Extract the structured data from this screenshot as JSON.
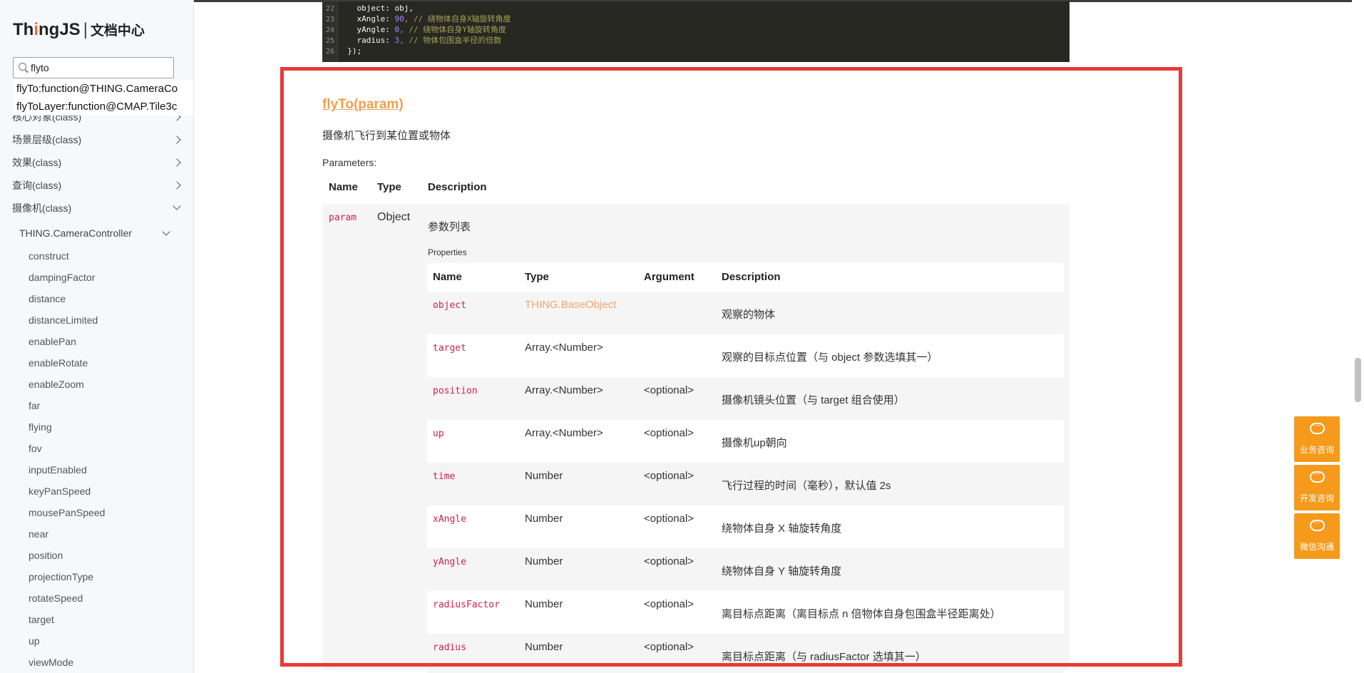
{
  "sidebar": {
    "logo_main_pre": "Th",
    "logo_main_i": "i",
    "logo_main_post": "ngJS",
    "logo_sep": "|",
    "logo_sub": "文档中心",
    "search_value": "flyto",
    "suggestions": [
      "flyTo:function@THING.CameraCo",
      "flyToLayer:function@CMAP.Tile3c"
    ],
    "nav_items": [
      "核心对象(class)",
      "场景层级(class)",
      "效果(class)",
      "查询(class)",
      "摄像机(class)"
    ],
    "sub_item": "THING.CameraController",
    "leaf_items": [
      "construct",
      "dampingFactor",
      "distance",
      "distanceLimited",
      "enablePan",
      "enableRotate",
      "enableZoom",
      "far",
      "flying",
      "fov",
      "inputEnabled",
      "keyPanSpeed",
      "mousePanSpeed",
      "near",
      "position",
      "projectionType",
      "rotateSpeed",
      "target",
      "up",
      "viewMode"
    ]
  },
  "code": {
    "lines": [
      {
        "n": "22",
        "key": "    object: ",
        "val": "obj,",
        "val_type": "plain",
        "comment": ""
      },
      {
        "n": "23",
        "key": "    xAngle: ",
        "val": "90",
        "val_type": "num",
        "comment": ", // 绕物体自身X轴旋转角度"
      },
      {
        "n": "24",
        "key": "    yAngle: ",
        "val": "0",
        "val_type": "num",
        "comment": ", // 绕物体自身Y轴旋转角度"
      },
      {
        "n": "25",
        "key": "    radius: ",
        "val": "3",
        "val_type": "num",
        "comment": ", // 物体包围盒半径的倍数"
      },
      {
        "n": "26",
        "key": "  });",
        "val": "",
        "val_type": "plain",
        "comment": ""
      }
    ]
  },
  "doc": {
    "method_title": "flyTo(param)",
    "summary": "摄像机飞行到某位置或物体",
    "parameters_label": "Parameters:",
    "table_headers": {
      "name": "Name",
      "type": "Type",
      "description": "Description"
    },
    "param": {
      "name": "param",
      "type": "Object",
      "description": "参数列表"
    },
    "properties_label": "Properties",
    "prop_headers": {
      "name": "Name",
      "type": "Type",
      "argument": "Argument",
      "description": "Description"
    },
    "properties": [
      {
        "name": "object",
        "type": "THING.BaseObject",
        "argument": "",
        "description": "观察的物体"
      },
      {
        "name": "target",
        "type": "Array.<Number>",
        "argument": "",
        "description": "观察的目标点位置（与 object 参数选填其一）"
      },
      {
        "name": "position",
        "type": "Array.<Number>",
        "argument": "<optional>",
        "description": "摄像机镜头位置（与 target 组合使用）"
      },
      {
        "name": "up",
        "type": "Array.<Number>",
        "argument": "<optional>",
        "description": "摄像机up朝向"
      },
      {
        "name": "time",
        "type": "Number",
        "argument": "<optional>",
        "description": "飞行过程的时间（毫秒），默认值 2s"
      },
      {
        "name": "xAngle",
        "type": "Number",
        "argument": "<optional>",
        "description": "绕物体自身 X 轴旋转角度"
      },
      {
        "name": "yAngle",
        "type": "Number",
        "argument": "<optional>",
        "description": "绕物体自身 Y 轴旋转角度"
      },
      {
        "name": "radiusFactor",
        "type": "Number",
        "argument": "<optional>",
        "description": "离目标点距离（离目标点 n 倍物体自身包围盒半径距离处）"
      },
      {
        "name": "radius",
        "type": "Number",
        "argument": "<optional>",
        "description": "离目标点距离（与 radiusFactor 选填其一）"
      }
    ]
  },
  "float_buttons": [
    {
      "label": "业务咨询",
      "icon": "chat-bubble-icon"
    },
    {
      "label": "开发咨询",
      "icon": "chat-bubble-icon"
    },
    {
      "label": "微信沟通",
      "icon": "wechat-icon"
    }
  ],
  "colors": {
    "accent_orange": "#f59a1b",
    "highlight_red": "#ec3838",
    "param_red": "#c7254e",
    "link_orange": "#f0a050"
  }
}
